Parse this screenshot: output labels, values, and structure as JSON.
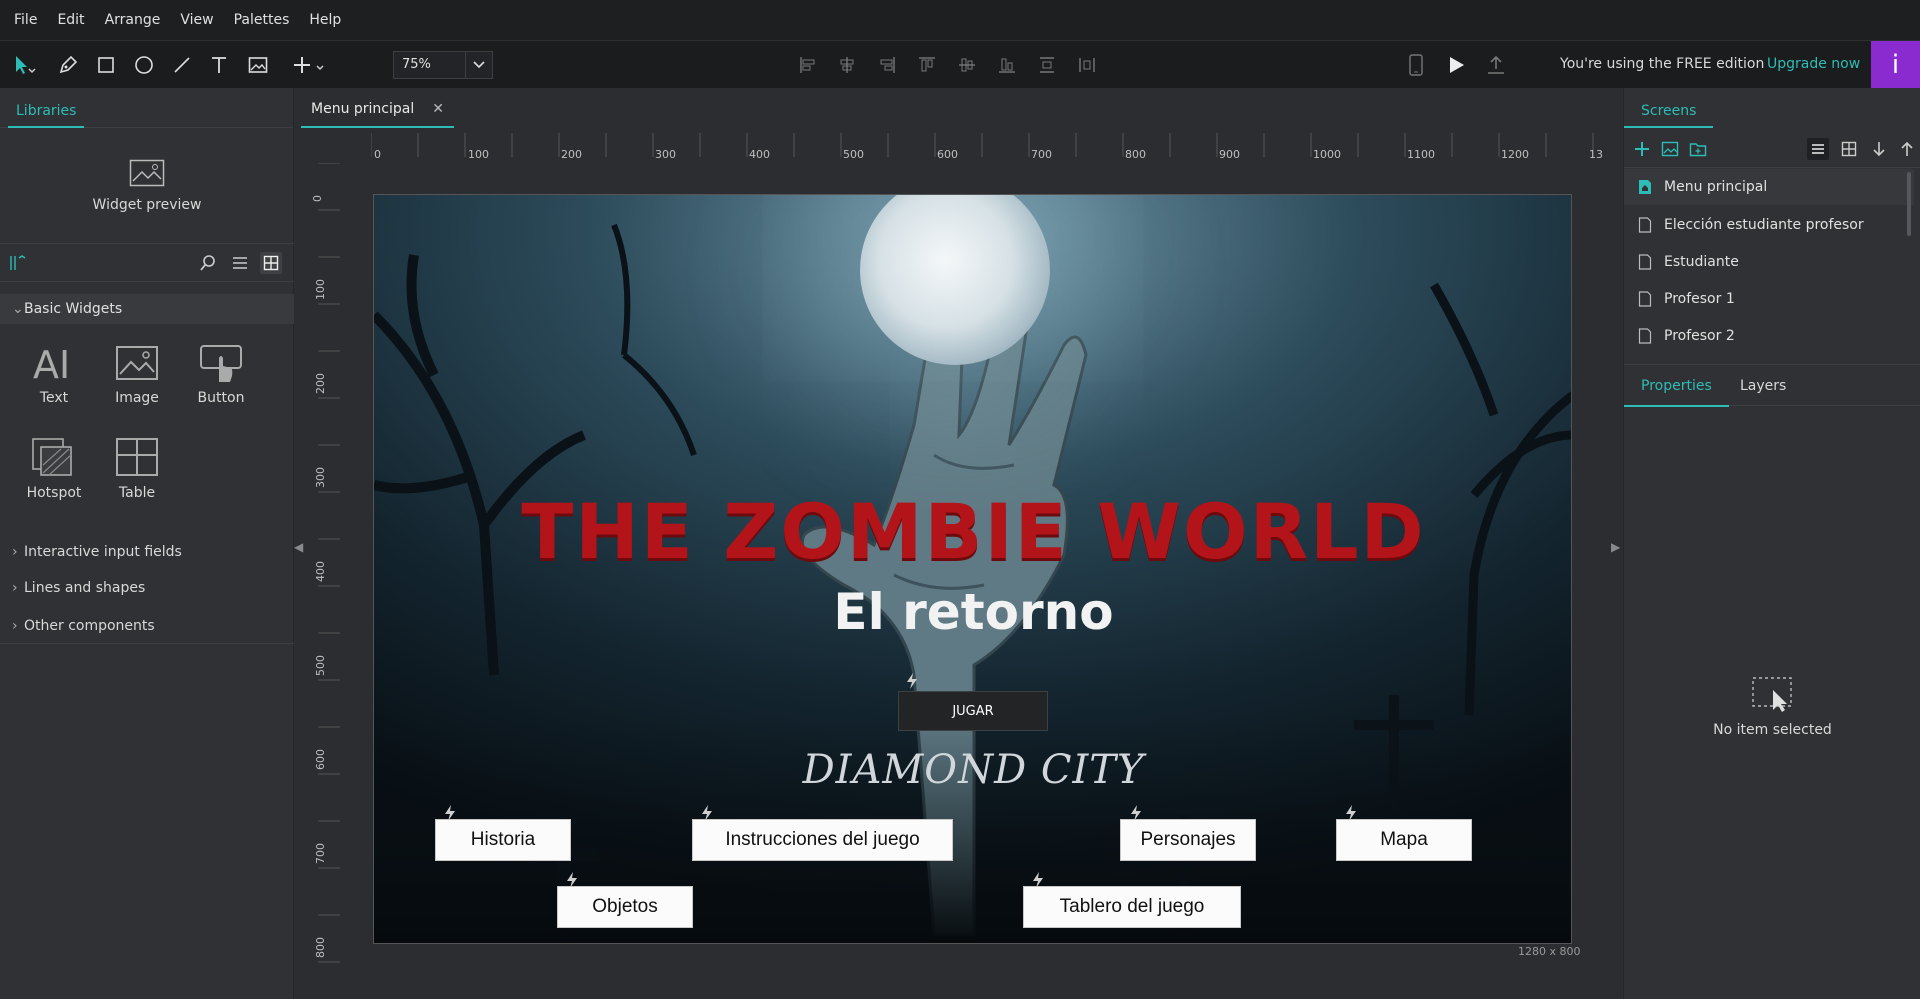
{
  "menubar": {
    "items": [
      "File",
      "Edit",
      "Arrange",
      "View",
      "Palettes",
      "Help"
    ]
  },
  "toolbar": {
    "zoom_value": "75%",
    "tool_icons": [
      "select-icon",
      "pen-icon",
      "rectangle-icon",
      "ellipse-icon",
      "line-icon",
      "text-tool-icon",
      "image-tool-icon",
      "add-icon"
    ],
    "align_icons": [
      "align-left-icon",
      "align-center-icon",
      "align-right-icon",
      "align-top-icon",
      "align-middle-icon",
      "align-bottom-icon",
      "distribute-vertical-icon",
      "distribute-horizontal-icon"
    ],
    "free_edition_text": "You're using the FREE edition",
    "upgrade_label": "Upgrade now",
    "info_label": "i",
    "accent_color": "#2dbdb6",
    "info_color": "#8a2bd0"
  },
  "libraries": {
    "tab_label": "Libraries",
    "widget_preview_label": "Widget preview",
    "basic_widgets_label": "Basic Widgets",
    "widgets": [
      {
        "label": "Text",
        "icon": "text-widget-icon"
      },
      {
        "label": "Image",
        "icon": "image-widget-icon"
      },
      {
        "label": "Button",
        "icon": "button-widget-icon"
      },
      {
        "label": "Hotspot",
        "icon": "hotspot-widget-icon"
      },
      {
        "label": "Table",
        "icon": "table-widget-icon"
      }
    ],
    "sections": [
      "Interactive input fields",
      "Lines and shapes",
      "Other components"
    ]
  },
  "canvas": {
    "doc_tab_label": "Menu principal",
    "ruler_top": [
      "0",
      "100",
      "200",
      "300",
      "400",
      "500",
      "600",
      "700",
      "800",
      "900",
      "1000",
      "1100",
      "1200",
      "13"
    ],
    "ruler_left": [
      "0",
      "100",
      "200",
      "300",
      "400",
      "500",
      "600",
      "700",
      "800"
    ],
    "screen_size_label": "1280 x 800",
    "game_title": "THE ZOMBIE WORLD",
    "game_subtitle": "El retorno",
    "play_button": "JUGAR",
    "city_name": "DIAMOND CITY",
    "buttons": {
      "historia": "Historia",
      "instrucciones": "Instrucciones del juego",
      "personajes": "Personajes",
      "mapa": "Mapa",
      "objetos": "Objetos",
      "tablero": "Tablero del juego"
    },
    "title_color": "#b3141a"
  },
  "screens_panel": {
    "tab_label": "Screens",
    "items": [
      "Menu principal",
      "Elección estudiante profesor",
      "Estudiante",
      "Profesor 1",
      "Profesor 2"
    ],
    "active_index": 0
  },
  "properties_panel": {
    "properties_tab": "Properties",
    "layers_tab": "Layers",
    "empty_text": "No item selected"
  }
}
